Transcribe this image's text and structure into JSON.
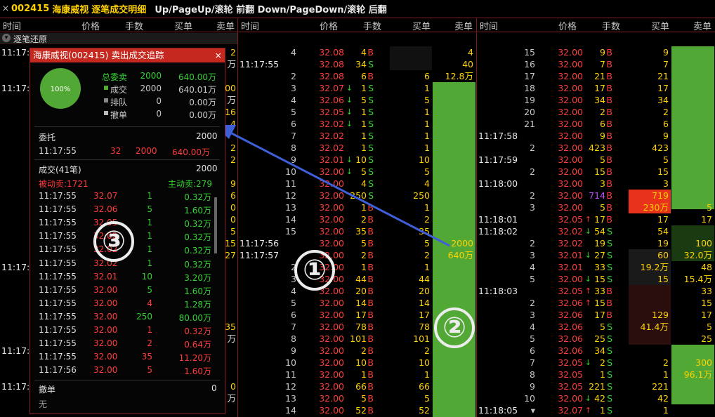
{
  "title_bar": {
    "close_glyph": "×",
    "stock_code": "002415",
    "stock_name": "海康威视",
    "window_title": "逐笔成交明细",
    "key_hint": "Up/PageUp/滚轮 前翻 Down/PageDown/滚轮 后翻"
  },
  "column_headers": {
    "time": "时间",
    "price": "价格",
    "volume": "手数",
    "buy_order": "买单",
    "sell_order": "卖单"
  },
  "left_column": {
    "restore_label": "逐笔还原",
    "times": [
      {
        "label": "11:17:",
        "row": 0
      },
      {
        "label": "11:17:",
        "row": 3
      },
      {
        "label": "11:17:",
        "row": 18
      },
      {
        "label": "11:17:",
        "row": 25
      },
      {
        "label": "11:17:",
        "row": 28
      }
    ],
    "right_values": [
      {
        "label": "2",
        "row": 0
      },
      {
        "label": "万",
        "row": 1
      },
      {
        "label": "00",
        "row": 3
      },
      {
        "label": "万",
        "row": 4
      },
      {
        "label": "16",
        "row": 5
      },
      {
        "label": "4",
        "row": 6
      },
      {
        "label": "2",
        "row": 8
      },
      {
        "label": "2",
        "row": 9
      },
      {
        "label": "9",
        "row": 11
      },
      {
        "label": "6",
        "row": 12
      },
      {
        "label": "0",
        "row": 13
      },
      {
        "label": "0",
        "row": 14
      },
      {
        "label": "5",
        "row": 15
      },
      {
        "label": "15",
        "row": 16
      },
      {
        "label": "27",
        "row": 17
      },
      {
        "label": "35",
        "row": 23
      },
      {
        "label": "万",
        "row": 24
      },
      {
        "label": "0",
        "row": 28
      },
      {
        "label": "万",
        "row": 29
      }
    ]
  },
  "middle_column": {
    "rows": [
      {
        "time": "",
        "seq": "4",
        "price": "32.08",
        "arrow": "",
        "vol": "4",
        "side": "B",
        "buy": "",
        "sell": "4"
      },
      {
        "time": "11:17:55",
        "seq": "",
        "price": "32.08",
        "arrow": "",
        "vol": "34",
        "side": "S",
        "buy": "",
        "sell": "40"
      },
      {
        "time": "",
        "seq": "2",
        "price": "32.08",
        "arrow": "",
        "vol": "6",
        "side": "B",
        "buy": "6",
        "sell": "12.8万"
      },
      {
        "time": "",
        "seq": "3",
        "price": "32.07",
        "arrow": "down",
        "vol": "1",
        "side": "S",
        "buy": "1",
        "sell": ""
      },
      {
        "time": "",
        "seq": "4",
        "price": "32.06",
        "arrow": "down",
        "vol": "5",
        "side": "S",
        "buy": "5",
        "sell": ""
      },
      {
        "time": "",
        "seq": "5",
        "price": "32.05",
        "arrow": "down",
        "vol": "1",
        "side": "S",
        "buy": "1",
        "sell": ""
      },
      {
        "time": "",
        "seq": "6",
        "price": "32.02",
        "arrow": "down",
        "vol": "1",
        "side": "S",
        "buy": "1",
        "sell": ""
      },
      {
        "time": "",
        "seq": "7",
        "price": "32.02",
        "arrow": "",
        "vol": "1",
        "side": "S",
        "buy": "1",
        "sell": ""
      },
      {
        "time": "",
        "seq": "8",
        "price": "32.02",
        "arrow": "",
        "vol": "1",
        "side": "S",
        "buy": "1",
        "sell": ""
      },
      {
        "time": "",
        "seq": "9",
        "price": "32.01",
        "arrow": "down",
        "vol": "10",
        "side": "S",
        "buy": "10",
        "sell": ""
      },
      {
        "time": "",
        "seq": "10",
        "price": "32.00",
        "arrow": "down",
        "vol": "5",
        "side": "S",
        "buy": "5",
        "sell": ""
      },
      {
        "time": "",
        "seq": "11",
        "price": "32.00",
        "arrow": "",
        "vol": "4",
        "side": "S",
        "buy": "4",
        "sell": ""
      },
      {
        "time": "",
        "seq": "12",
        "price": "32.00",
        "arrow": "",
        "vol": "250",
        "side": "S",
        "buy": "250",
        "sell": ""
      },
      {
        "time": "",
        "seq": "13",
        "price": "32.00",
        "arrow": "",
        "vol": "1",
        "side": "B",
        "buy": "1",
        "sell": ""
      },
      {
        "time": "",
        "seq": "14",
        "price": "32.00",
        "arrow": "",
        "vol": "2",
        "side": "B",
        "buy": "2",
        "sell": ""
      },
      {
        "time": "",
        "seq": "15",
        "price": "32.00",
        "arrow": "",
        "vol": "35",
        "side": "B",
        "buy": "35",
        "sell": ""
      },
      {
        "time": "11:17:56",
        "seq": "",
        "price": "32.00",
        "arrow": "",
        "vol": "5",
        "side": "B",
        "buy": "5",
        "sell": "2000"
      },
      {
        "time": "11:17:57",
        "seq": "",
        "price": "32.00",
        "arrow": "",
        "vol": "2",
        "side": "B",
        "buy": "2",
        "sell": "640万"
      },
      {
        "time": "",
        "seq": "2",
        "price": "32.00",
        "arrow": "",
        "vol": "1",
        "side": "B",
        "buy": "1",
        "sell": ""
      },
      {
        "time": "",
        "seq": "3",
        "price": "32.00",
        "arrow": "",
        "vol": "44",
        "side": "B",
        "buy": "44",
        "sell": ""
      },
      {
        "time": "",
        "seq": "4",
        "price": "32.00",
        "arrow": "",
        "vol": "20",
        "side": "B",
        "buy": "20",
        "sell": ""
      },
      {
        "time": "",
        "seq": "5",
        "price": "32.00",
        "arrow": "",
        "vol": "14",
        "side": "B",
        "buy": "14",
        "sell": ""
      },
      {
        "time": "",
        "seq": "6",
        "price": "32.00",
        "arrow": "",
        "vol": "17",
        "side": "B",
        "buy": "17",
        "sell": ""
      },
      {
        "time": "",
        "seq": "7",
        "price": "32.00",
        "arrow": "",
        "vol": "78",
        "side": "B",
        "buy": "78",
        "sell": ""
      },
      {
        "time": "",
        "seq": "8",
        "price": "32.00",
        "arrow": "",
        "vol": "101",
        "side": "B",
        "buy": "101",
        "sell": ""
      },
      {
        "time": "",
        "seq": "9",
        "price": "32.00",
        "arrow": "",
        "vol": "2",
        "side": "B",
        "buy": "2",
        "sell": ""
      },
      {
        "time": "",
        "seq": "10",
        "price": "32.00",
        "arrow": "",
        "vol": "10",
        "side": "B",
        "buy": "10",
        "sell": ""
      },
      {
        "time": "",
        "seq": "11",
        "price": "32.00",
        "arrow": "",
        "vol": "1",
        "side": "B",
        "buy": "1",
        "sell": ""
      },
      {
        "time": "",
        "seq": "12",
        "price": "32.00",
        "arrow": "",
        "vol": "66",
        "side": "B",
        "buy": "66",
        "sell": ""
      },
      {
        "time": "",
        "seq": "13",
        "price": "32.00",
        "arrow": "",
        "vol": "5",
        "side": "B",
        "buy": "5",
        "sell": ""
      },
      {
        "time": "",
        "seq": "14",
        "price": "32.00",
        "arrow": "",
        "vol": "52",
        "side": "B",
        "buy": "52",
        "sell": ""
      }
    ]
  },
  "right_column": {
    "rows": [
      {
        "time": "",
        "seq": "15",
        "price": "32.00",
        "arrow": "",
        "vol": "9",
        "side": "B",
        "buy": "9",
        "sell": ""
      },
      {
        "time": "",
        "seq": "16",
        "price": "32.00",
        "arrow": "",
        "vol": "7",
        "side": "B",
        "buy": "7",
        "sell": ""
      },
      {
        "time": "",
        "seq": "17",
        "price": "32.00",
        "arrow": "",
        "vol": "21",
        "side": "B",
        "buy": "21",
        "sell": ""
      },
      {
        "time": "",
        "seq": "18",
        "price": "32.00",
        "arrow": "",
        "vol": "17",
        "side": "B",
        "buy": "17",
        "sell": ""
      },
      {
        "time": "",
        "seq": "19",
        "price": "32.00",
        "arrow": "",
        "vol": "34",
        "side": "B",
        "buy": "34",
        "sell": ""
      },
      {
        "time": "",
        "seq": "20",
        "price": "32.00",
        "arrow": "",
        "vol": "2",
        "side": "B",
        "buy": "2",
        "sell": ""
      },
      {
        "time": "",
        "seq": "21",
        "price": "32.00",
        "arrow": "",
        "vol": "6",
        "side": "B",
        "buy": "6",
        "sell": ""
      },
      {
        "time": "11:17:58",
        "seq": "",
        "price": "32.00",
        "arrow": "",
        "vol": "9",
        "side": "B",
        "buy": "9",
        "sell": ""
      },
      {
        "time": "",
        "seq": "2",
        "price": "32.00",
        "arrow": "",
        "vol": "423",
        "side": "B",
        "buy": "423",
        "sell": ""
      },
      {
        "time": "11:17:59",
        "seq": "",
        "price": "32.00",
        "arrow": "",
        "vol": "5",
        "side": "B",
        "buy": "5",
        "sell": ""
      },
      {
        "time": "",
        "seq": "2",
        "price": "32.00",
        "arrow": "",
        "vol": "15",
        "side": "B",
        "buy": "15",
        "sell": ""
      },
      {
        "time": "11:18:00",
        "seq": "",
        "price": "32.00",
        "arrow": "",
        "vol": "3",
        "side": "B",
        "buy": "3",
        "sell": ""
      },
      {
        "time": "",
        "seq": "2",
        "price": "32.00",
        "arrow": "",
        "vol": "714",
        "side": "B",
        "buy": "719",
        "sell": ""
      },
      {
        "time": "",
        "seq": "3",
        "price": "32.00",
        "arrow": "",
        "vol": "5",
        "side": "B",
        "buy": "230万",
        "sell": "5"
      },
      {
        "time": "11:18:01",
        "seq": "",
        "price": "32.05",
        "arrow": "up",
        "vol": "17",
        "side": "B",
        "buy": "17",
        "sell": "17"
      },
      {
        "time": "11:18:02",
        "seq": "",
        "price": "32.02",
        "arrow": "down",
        "vol": "54",
        "side": "S",
        "buy": "54",
        "sell": ""
      },
      {
        "time": "",
        "seq": "2",
        "price": "32.02",
        "arrow": "",
        "vol": "19",
        "side": "S",
        "buy": "19",
        "sell": "100"
      },
      {
        "time": "",
        "seq": "3",
        "price": "32.01",
        "arrow": "down",
        "vol": "27",
        "side": "S",
        "buy": "60",
        "sell": "32.0万"
      },
      {
        "time": "",
        "seq": "4",
        "price": "32.01",
        "arrow": "",
        "vol": "33",
        "side": "S",
        "buy": "19.2万",
        "sell": "48"
      },
      {
        "time": "",
        "seq": "5",
        "price": "32.00",
        "arrow": "down",
        "vol": "15",
        "side": "S",
        "buy": "15",
        "sell": "15.4万"
      },
      {
        "time": "11:18:03",
        "seq": "",
        "price": "32.05",
        "arrow": "up",
        "vol": "33",
        "side": "B",
        "buy": "",
        "sell": "33"
      },
      {
        "time": "",
        "seq": "2",
        "price": "32.06",
        "arrow": "up",
        "vol": "15",
        "side": "B",
        "buy": "",
        "sell": "15"
      },
      {
        "time": "",
        "seq": "3",
        "price": "32.06",
        "arrow": "",
        "vol": "17",
        "side": "B",
        "buy": "129",
        "sell": "17"
      },
      {
        "time": "",
        "seq": "4",
        "price": "32.06",
        "arrow": "",
        "vol": "5",
        "side": "S",
        "buy": "41.4万",
        "sell": "5"
      },
      {
        "time": "",
        "seq": "5",
        "price": "32.06",
        "arrow": "",
        "vol": "25",
        "side": "S",
        "buy": "",
        "sell": "25"
      },
      {
        "time": "",
        "seq": "6",
        "price": "32.06",
        "arrow": "",
        "vol": "34",
        "side": "S",
        "buy": "",
        "sell": ""
      },
      {
        "time": "",
        "seq": "7",
        "price": "32.05",
        "arrow": "down",
        "vol": "2",
        "side": "S",
        "buy": "2",
        "sell": "300"
      },
      {
        "time": "",
        "seq": "8",
        "price": "32.05",
        "arrow": "",
        "vol": "1",
        "side": "S",
        "buy": "1",
        "sell": "96.1万"
      },
      {
        "time": "",
        "seq": "9",
        "price": "32.05",
        "arrow": "",
        "vol": "221",
        "side": "S",
        "buy": "221",
        "sell": ""
      },
      {
        "time": "",
        "seq": "10",
        "price": "32.00",
        "arrow": "down",
        "vol": "42",
        "side": "S",
        "buy": "42",
        "sell": ""
      },
      {
        "time": "11:18:05",
        "seq": "▾",
        "price": "32.07",
        "arrow": "up",
        "vol": "1",
        "side": "S",
        "buy": "1",
        "sell": ""
      }
    ]
  },
  "popup": {
    "title": "海康威视(002415) 卖出成交追踪",
    "close_glyph": "×",
    "pie_label": "100%",
    "pie_fraction": 1.0,
    "summary": [
      {
        "label": "总委卖",
        "count": "2000",
        "amount": "640.00万"
      },
      {
        "label": "成交",
        "count": "2000",
        "amount": "640.01万"
      },
      {
        "label": "排队",
        "count": "0",
        "amount": "0.00万"
      },
      {
        "label": "撤单",
        "count": "0",
        "amount": "0.00万"
      }
    ],
    "order_label": "委托",
    "order_total": "2000",
    "order_row": {
      "time": "11:17:55",
      "price": "32",
      "vol": "2000",
      "amount": "640.00万"
    },
    "trade_label": "成交(41笔)",
    "trade_total": "2000",
    "passive_label": "被动卖:1721",
    "active_label": "主动卖:279",
    "trades": [
      {
        "time": "11:17:55",
        "price": "32.07",
        "vol": "1",
        "amount": "0.32万"
      },
      {
        "time": "11:17:55",
        "price": "32.06",
        "vol": "5",
        "amount": "1.60万"
      },
      {
        "time": "11:17:55",
        "price": "32.05",
        "vol": "1",
        "amount": "0.32万"
      },
      {
        "time": "11:17:55",
        "price": "32.02",
        "vol": "1",
        "amount": "0.32万"
      },
      {
        "time": "11:17:55",
        "price": "32.02",
        "vol": "1",
        "amount": "0.32万"
      },
      {
        "time": "11:17:55",
        "price": "32.02",
        "vol": "1",
        "amount": "0.32万"
      },
      {
        "time": "11:17:55",
        "price": "32.01",
        "vol": "10",
        "amount": "3.20万"
      },
      {
        "time": "11:17:55",
        "price": "32.00",
        "vol": "5",
        "amount": "1.60万"
      },
      {
        "time": "11:17:55",
        "price": "32.00",
        "vol": "4",
        "amount": "1.28万"
      },
      {
        "time": "11:17:55",
        "price": "32.00",
        "vol": "250",
        "amount": "80.00万"
      },
      {
        "time": "11:17:55",
        "price": "32.00",
        "vol": "1",
        "amount": "0.32万"
      },
      {
        "time": "11:17:55",
        "price": "32.00",
        "vol": "2",
        "amount": "0.64万"
      },
      {
        "time": "11:17:55",
        "price": "32.00",
        "vol": "35",
        "amount": "11.20万"
      },
      {
        "time": "11:17:56",
        "price": "32.00",
        "vol": "5",
        "amount": "1.60万"
      }
    ],
    "cancel_label": "撤单",
    "cancel_total": "0",
    "cancel_none": "无"
  },
  "annotations": {
    "circle_1": "①",
    "circle_2": "②",
    "circle_3": "③"
  },
  "colors": {
    "up_red": "#ff3b3b",
    "down_green": "#34d134",
    "highlight_green": "#52a834",
    "highlight_red": "#e8321a",
    "border": "#7a1c1c",
    "popup_header": "#c4281e"
  }
}
